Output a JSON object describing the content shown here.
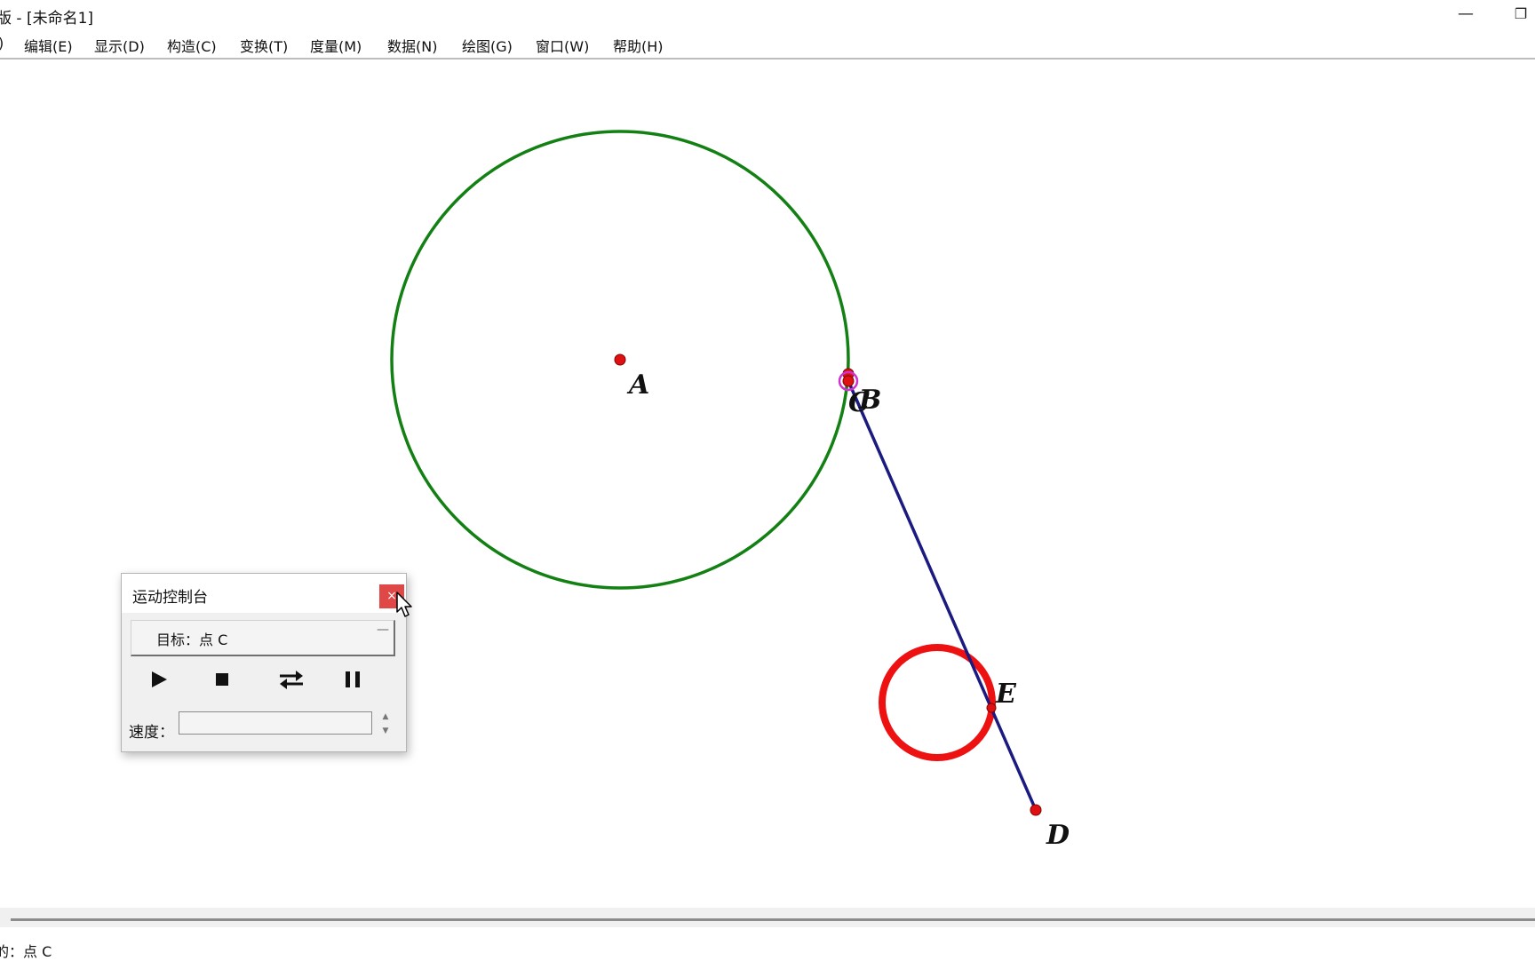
{
  "window": {
    "title": "版 - [未命名1]",
    "minimize_glyph": "—",
    "restore_glyph": "❐"
  },
  "menu": {
    "items": [
      {
        "label": ")"
      },
      {
        "label": "编辑(E)"
      },
      {
        "label": "显示(D)"
      },
      {
        "label": "构造(C)"
      },
      {
        "label": "变换(T)"
      },
      {
        "label": "度量(M)"
      },
      {
        "label": "数据(N)"
      },
      {
        "label": "绘图(G)"
      },
      {
        "label": "窗口(W)"
      },
      {
        "label": "帮助(H)"
      }
    ]
  },
  "geometry": {
    "labels": {
      "A": "A",
      "B": "B",
      "C": "C",
      "D": "D",
      "E": "E"
    },
    "colors": {
      "big_circle": "#138013",
      "small_circle": "#ee1111",
      "segment": "#1a1a80",
      "point": "#dd1111",
      "selection": "#cc33cc"
    }
  },
  "motion_controller": {
    "title": "运动控制台",
    "close_glyph": "×",
    "target_label": "目标：点 C",
    "target_caret": "—",
    "speed_label": "速度：",
    "speed_value": "",
    "icons": [
      "play-icon",
      "stop-icon",
      "reverse-icon",
      "pause-icon"
    ]
  },
  "status": {
    "text": "的：点 C"
  }
}
